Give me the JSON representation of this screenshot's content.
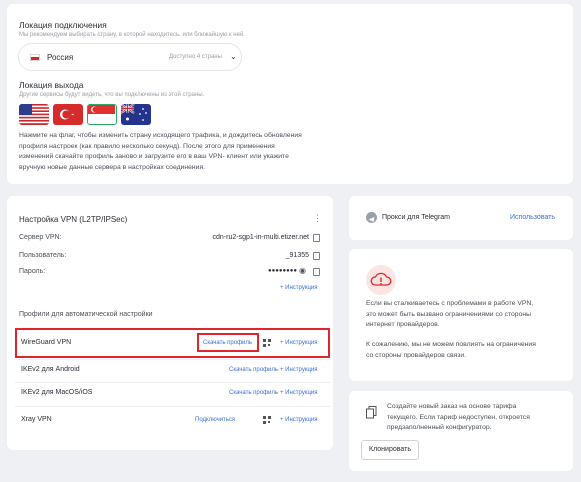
{
  "location": {
    "title": "Локация подключения",
    "subtitle": "Мы рекомендуем выбирать страну, в которой находитесь, или ближайшую к ней.",
    "country": "Россия",
    "available": "Доступно 4 страны"
  },
  "exit": {
    "title": "Локация выхода",
    "subtitle": "Другие сервисы будут видеть, что вы подключены из этой страны.",
    "flags": [
      "usa-flag",
      "turkey-flag",
      "singapore-flag",
      "australia-flag"
    ],
    "description_1": "Нажмите на флаг, чтобы изменить страну исходящего трафика, и дождитесь обновления",
    "description_2": "профиля настроек (как правило несколько секунд). После этого для применения",
    "description_3": "изменений скачайте профиль заново и загрузите его в ваш VPN- клиент или укажите",
    "description_4": "вручную новые данные сервера в настройках соединения."
  },
  "vpn": {
    "title": "Настройка VPN (L2TP/IPSec)",
    "server_label": "Сервер VPN:",
    "server_value": "cdn-ru2-sgp1-in-multi.etizer.net",
    "user_label": "Пользователь:",
    "user_value": "_91355",
    "pass_label": "Пароль:",
    "pass_value": "●●●●●●●●",
    "instructions": "Инструкция",
    "profiles_title": "Профили для автоматической настройки",
    "profiles": [
      {
        "name": "WireGuard VPN",
        "download": "Скачать профиль",
        "instr": "+ Инструкция"
      },
      {
        "name": "IKEv2 для Android",
        "download": "Скачать профиль",
        "instr": "+ Инструкция"
      },
      {
        "name": "IKEv2 для MacOS/iOS",
        "download": "Скачать профиль",
        "instr": "+ Инструкция"
      },
      {
        "name": "Xray VPN",
        "download": "Подключиться",
        "instr": "+ Инструкция"
      }
    ]
  },
  "telegram": {
    "label": "Прокси для Telegram",
    "action": "Использовать"
  },
  "problem": {
    "p1_1": "Если вы сталкиваетесь с проблемами в работе VPN,",
    "p1_2": "это может быть вызвано ограничениями со стороны",
    "p1_3": "интернет провайдеров.",
    "p2_1": "К сожалению, мы не можем повлиять на ограничения",
    "p2_2": "со стороны провайдеров связи."
  },
  "order": {
    "text_1": "Создайте новый заказ на основе тарифа",
    "text_2": "текущего. Если тариф недоступен, откроется",
    "text_3": "предзаполненный конфигуратор.",
    "button": "Клонировать"
  }
}
